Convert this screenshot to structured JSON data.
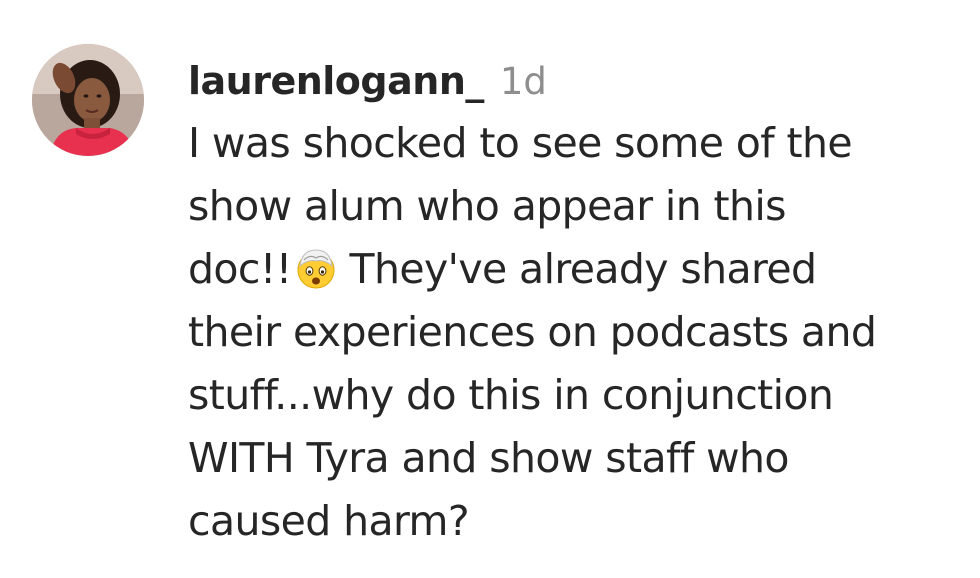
{
  "comment": {
    "username": "laurenlogann_",
    "timestamp": "1d",
    "avatar_icon": "profile-photo-avatar",
    "text_lines": [
      "I was shocked to see some of the",
      "show alum who appear in this",
      "doc!!",
      "They've already shared",
      "their experiences on podcasts and",
      "stuff...why do this in conjunction",
      "WITH Tyra and show staff who",
      "caused harm?"
    ],
    "emoji_icon": "exploding-head-emoji-icon",
    "colors": {
      "username": "#262626",
      "timestamp": "#8e8e8e",
      "text": "#262626",
      "avatar_accent": "#e8314f"
    }
  }
}
